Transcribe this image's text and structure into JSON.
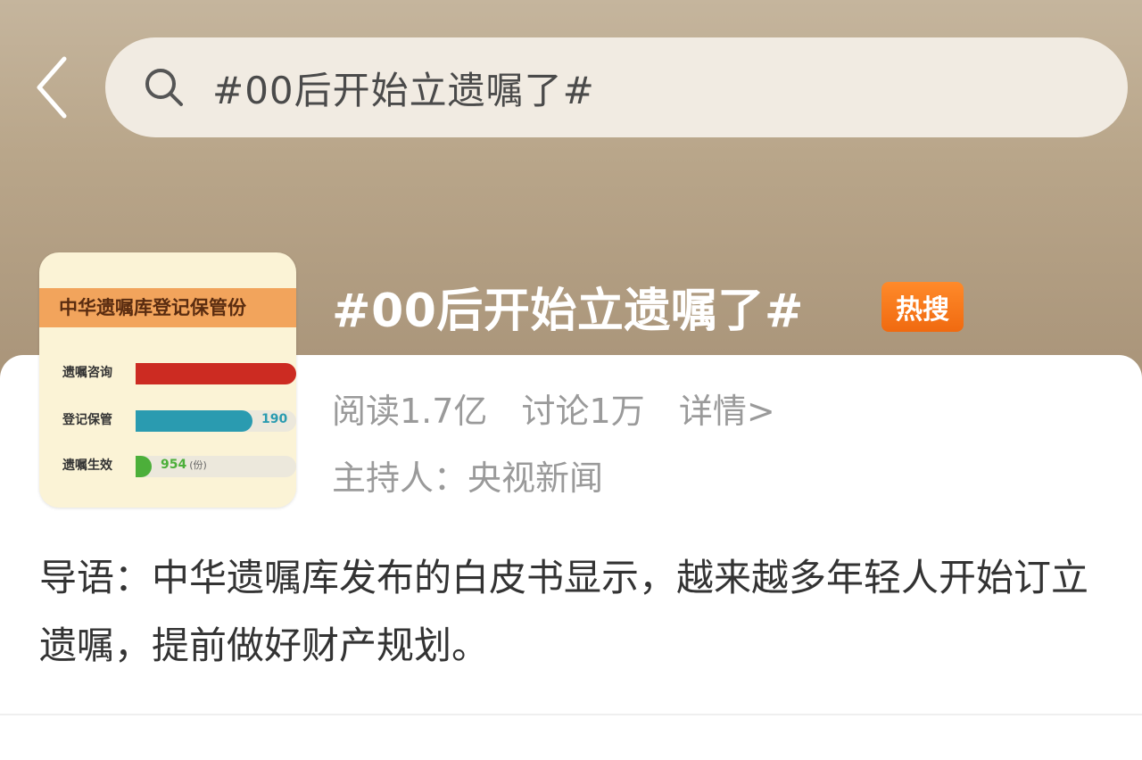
{
  "search": {
    "query": "#00后开始立遗嘱了#"
  },
  "icons": {
    "back": "chevron-left-icon",
    "search": "search-icon"
  },
  "colors": {
    "hot_badge": "#f47316",
    "header_bg": "#bba98d"
  },
  "topic": {
    "title": "#00后开始立遗嘱了#",
    "badge": "热搜",
    "reads": "阅读1.7亿",
    "discussions": "讨论1万",
    "detail_link": "详情>",
    "host": "主持人：央视新闻",
    "intro": "导语：中华遗嘱库发布的白皮书显示，越来越多年轻人开始订立遗嘱，提前做好财产规划。"
  },
  "thumbnail": {
    "title": "中华遗嘱库登记保管份",
    "rows": [
      {
        "label": "遗嘱咨询",
        "value": "",
        "unit": "",
        "color": "#cc2b22",
        "fill": 1.0
      },
      {
        "label": "登记保管",
        "value": "190",
        "unit": "",
        "color": "#2a9bb0",
        "fill": 0.73
      },
      {
        "label": "遗嘱生效",
        "value": "954",
        "unit": "(份)",
        "color": "#4caf3a",
        "fill": 0.1
      }
    ]
  }
}
